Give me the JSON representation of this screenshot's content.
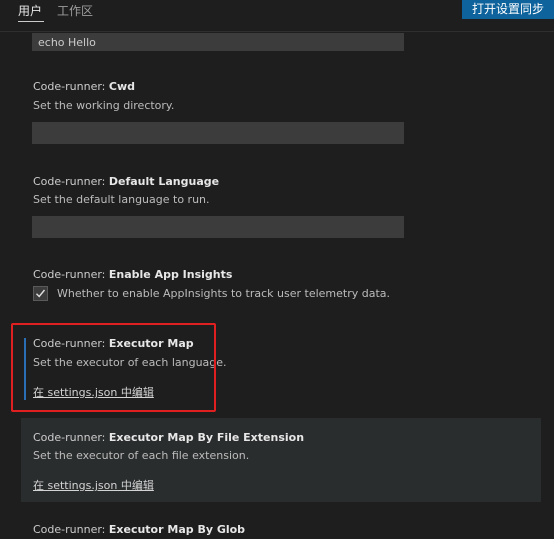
{
  "header": {
    "tabs": [
      {
        "label": "用户"
      },
      {
        "label": "工作区"
      }
    ],
    "sync_button": "打开设置同步"
  },
  "settings": [
    {
      "value": "echo Hello"
    },
    {
      "prefix": "Code-runner: ",
      "name": "Cwd",
      "description": "Set the working directory.",
      "value": ""
    },
    {
      "prefix": "Code-runner: ",
      "name": "Default Language",
      "description": "Set the default language to run.",
      "value": ""
    },
    {
      "prefix": "Code-runner: ",
      "name": "Enable App Insights",
      "description": "Whether to enable AppInsights to track user telemetry data.",
      "checked": true
    },
    {
      "prefix": "Code-runner: ",
      "name": "Executor Map",
      "description": "Set the executor of each language.",
      "link": "在 settings.json 中编辑"
    },
    {
      "prefix": "Code-runner: ",
      "name": "Executor Map By File Extension",
      "description": "Set the executor of each file extension.",
      "link": "在 settings.json 中编辑"
    },
    {
      "prefix": "Code-runner: ",
      "name": "Executor Map By Glob"
    }
  ],
  "colors": {
    "accent_button": "#0e639c",
    "annotation_box": "#e02020",
    "focus_bar": "#2a6fb3"
  }
}
